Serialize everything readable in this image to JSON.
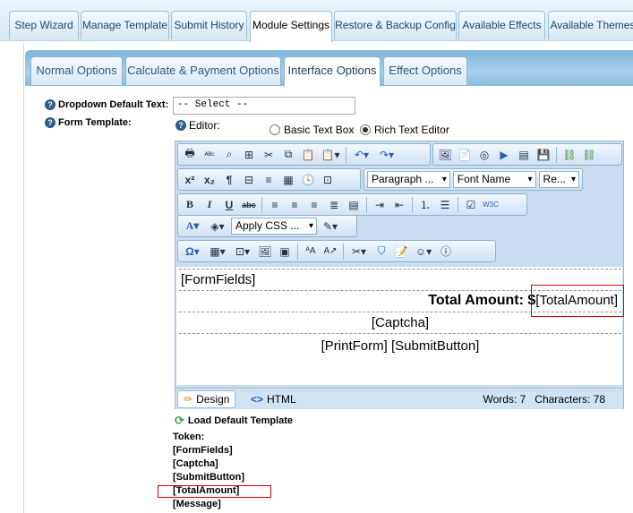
{
  "top_tabs": [
    "Step Wizard",
    "Manage Template",
    "Submit History",
    "Module Settings",
    "Restore & Backup Config",
    "Available Effects",
    "Available Themes"
  ],
  "sub_tabs": [
    "Normal Options",
    "Calculate & Payment Options",
    "Interface Options",
    "Effect Options"
  ],
  "fields": {
    "dropdown_label": "Dropdown Default Text:",
    "dropdown_value": "-- Select --",
    "form_template_label": "Form Template:",
    "editor_label": "Editor:",
    "radio_basic": "Basic Text Box",
    "radio_rich": "Rich Text Editor"
  },
  "toolbar": {
    "paragraph": "Paragraph ...",
    "font_name": "Font Name",
    "font_size": "Re...",
    "apply_css": "Apply CSS ..."
  },
  "content": {
    "form_fields": "[FormFields]",
    "total_label": "Total Amount: ",
    "total_dollar": "$",
    "total_token": "[TotalAmount]",
    "captcha": "[Captcha]",
    "print_submit": "[PrintForm] [SubmitButton]"
  },
  "statusbar": {
    "design": "Design",
    "html": "HTML",
    "stats": "Words: 7   Characters: 78"
  },
  "load_default": "Load Default Template",
  "tokens": [
    "Token:",
    "[FormFields]",
    "[Captcha]",
    "[SubmitButton]",
    "[TotalAmount]",
    "[Message]"
  ]
}
